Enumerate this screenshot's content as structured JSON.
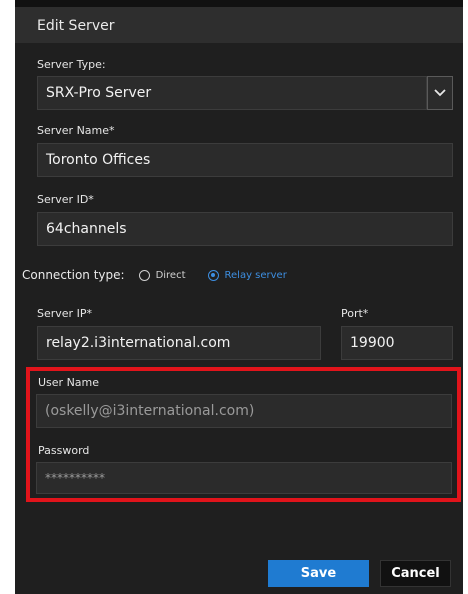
{
  "dialog": {
    "title": "Edit Server"
  },
  "server_type": {
    "label": "Server Type:",
    "value": "SRX-Pro Server"
  },
  "server_name": {
    "label": "Server Name*",
    "value": "Toronto Offices"
  },
  "server_id": {
    "label": "Server ID*",
    "value": "64channels"
  },
  "connection": {
    "label": "Connection type:",
    "options": [
      "Direct",
      "Relay server"
    ],
    "selected": "Relay server"
  },
  "server_ip": {
    "label": "Server IP*",
    "value": "relay2.i3international.com"
  },
  "port": {
    "label": "Port*",
    "value": "19900"
  },
  "user_name": {
    "label": "User Name",
    "value": "(oskelly@i3international.com)"
  },
  "password": {
    "label": "Password",
    "value": "**********"
  },
  "buttons": {
    "save": "Save",
    "cancel": "Cancel"
  },
  "colors": {
    "accent": "#1f7bd1",
    "highlight": "#e1141b",
    "background": "#1f1f1f"
  }
}
